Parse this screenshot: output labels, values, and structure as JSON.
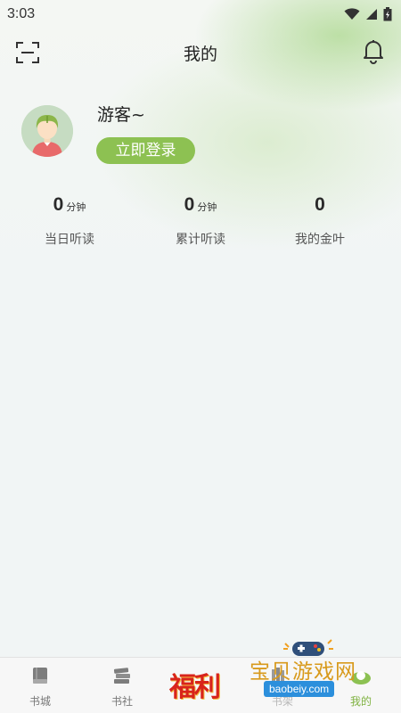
{
  "status_bar": {
    "time": "3:03"
  },
  "header": {
    "title": "我的"
  },
  "profile": {
    "username": "游客~",
    "login_label": "立即登录"
  },
  "stats": [
    {
      "value": "0",
      "unit": "分钟",
      "label": "当日听读"
    },
    {
      "value": "0",
      "unit": "分钟",
      "label": "累计听读"
    },
    {
      "value": "0",
      "unit": "",
      "label": "我的金叶"
    }
  ],
  "bottom_nav": {
    "items": [
      {
        "label": "书城",
        "icon": "book-icon"
      },
      {
        "label": "书社",
        "icon": "bookstack-icon"
      },
      {
        "label": "福利",
        "icon": "gift-icon"
      },
      {
        "label": "书架",
        "icon": "bookshelf-icon"
      },
      {
        "label": "我的",
        "icon": "profile-icon",
        "active": true
      }
    ],
    "fuli_badge": "福利"
  },
  "watermark": {
    "text": "宝贝游戏网",
    "url": "baobeiy.com"
  },
  "colors": {
    "accent": "#8dc152",
    "active_tab": "#7fb241",
    "background": "#f1f5f5"
  }
}
